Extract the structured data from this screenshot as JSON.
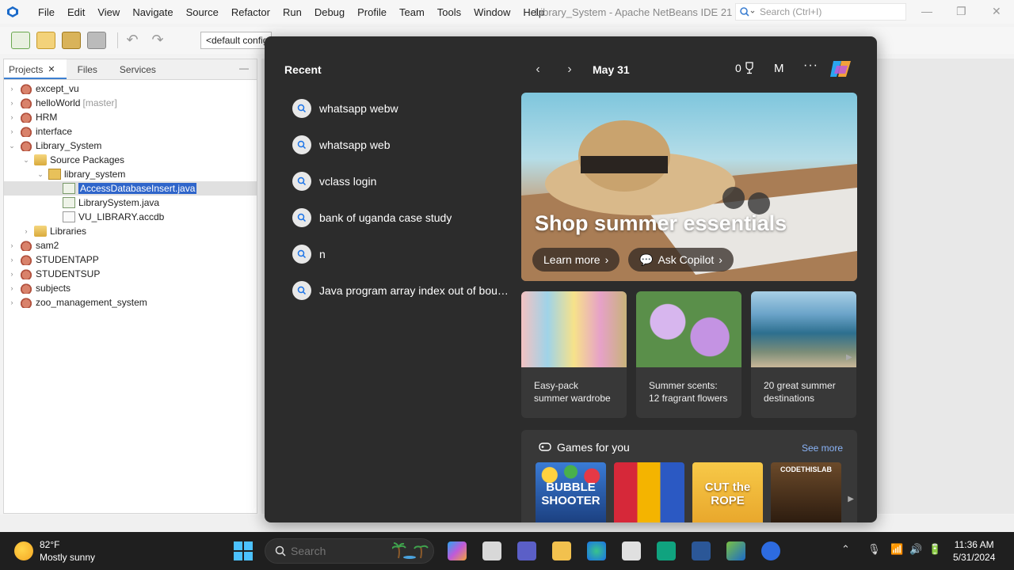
{
  "ide": {
    "menu": [
      "File",
      "Edit",
      "View",
      "Navigate",
      "Source",
      "Refactor",
      "Run",
      "Debug",
      "Profile",
      "Team",
      "Tools",
      "Window",
      "Help"
    ],
    "window_title": "Library_System - Apache NetBeans IDE 21",
    "search_placeholder": "Search (Ctrl+I)",
    "config": "<default config>",
    "tabs": [
      "Projects",
      "Files",
      "Services"
    ],
    "tree": [
      {
        "label": "except_vu"
      },
      {
        "label": "helloWorld",
        "suffix": "[master]"
      },
      {
        "label": "HRM"
      },
      {
        "label": "interface"
      },
      {
        "label": "Library_System"
      },
      {
        "label": "Source Packages"
      },
      {
        "label": "library_system"
      },
      {
        "label": "AccessDatabaseInsert.java"
      },
      {
        "label": "LibrarySystem.java"
      },
      {
        "label": "VU_LIBRARY.accdb"
      },
      {
        "label": "Libraries"
      },
      {
        "label": "sam2"
      },
      {
        "label": "STUDENTAPP"
      },
      {
        "label": "STUDENTSUP"
      },
      {
        "label": "subjects"
      },
      {
        "label": "zoo_management_system"
      }
    ]
  },
  "search_panel": {
    "recent_title": "Recent",
    "recent": [
      "whatsapp webw",
      "whatsapp web",
      "vclass login",
      "bank of uganda case study",
      "n",
      "Java program array index out of boun..."
    ],
    "date": "May 31",
    "points": "0",
    "avatar_initial": "M",
    "hero": {
      "title": "Shop summer essentials",
      "learn_more": "Learn more",
      "ask_copilot": "Ask Copilot"
    },
    "cards": [
      "Easy-pack summer wardrobe",
      "Summer scents: 12 fragrant flowers",
      "20 great summer destinations"
    ],
    "games_title": "Games for you",
    "see_more": "See more",
    "games": [
      "BUBBLE SHOOTER",
      "",
      "CUT the ROPE",
      "CODETHISLAB"
    ]
  },
  "taskbar": {
    "temperature": "82°F",
    "condition": "Mostly sunny",
    "search_placeholder": "Search",
    "time": "11:36 AM",
    "date": "5/31/2024"
  }
}
